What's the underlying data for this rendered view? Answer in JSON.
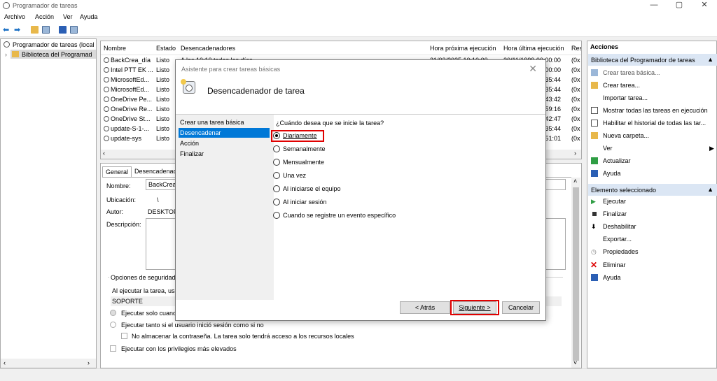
{
  "window": {
    "title": "Programador de tareas"
  },
  "menu": [
    "Archivo",
    "Acción",
    "Ver",
    "Ayuda"
  ],
  "tree": {
    "items": [
      "Programador de tareas (local",
      "Biblioteca del Programad"
    ]
  },
  "task_list": {
    "columns": [
      "Nombre",
      "Estado",
      "Desencadenadores",
      "Hora próxima ejecución",
      "Hora última ejecución",
      "Res"
    ],
    "rows": [
      {
        "name": "BackCrea_día",
        "status": "Listo",
        "trigger": "A las 10:10 todos los días",
        "next": "21/03/2025 10:10:00",
        "last": "30/11/1999 00:00:00",
        "res": "(0x"
      },
      {
        "name": "Intel PTT EK ...",
        "status": "Listo",
        "trigger": "",
        "next": "",
        "last": ":00:00",
        "res": "(0x"
      },
      {
        "name": "MicrosoftEd...",
        "status": "Listo",
        "trigger": "",
        "next": "",
        "last": ":35:44",
        "res": "(0x"
      },
      {
        "name": "MicrosoftEd...",
        "status": "Listo",
        "trigger": "",
        "next": "",
        "last": ":35:44",
        "res": "(0x"
      },
      {
        "name": "OneDrive Pe...",
        "status": "Listo",
        "trigger": "",
        "next": "",
        "last": ":43:42",
        "res": "(0x"
      },
      {
        "name": "OneDrive Re...",
        "status": "Listo",
        "trigger": "",
        "next": "",
        "last": ":59:16",
        "res": "(0x"
      },
      {
        "name": "OneDrive St...",
        "status": "Listo",
        "trigger": "",
        "next": "",
        "last": ":42:47",
        "res": "(0x"
      },
      {
        "name": "update-S-1-...",
        "status": "Listo",
        "trigger": "",
        "next": "",
        "last": ":35:44",
        "res": "(0x"
      },
      {
        "name": "update-sys",
        "status": "Listo",
        "trigger": "",
        "next": "",
        "last": ":51:01",
        "res": "(0x"
      }
    ]
  },
  "details": {
    "tabs": [
      "General",
      "Desencadenac"
    ],
    "name_label": "Nombre:",
    "name_value": "BackCrea_",
    "location_label": "Ubicación:",
    "location_value": "\\",
    "author_label": "Autor:",
    "author_value": "DESKTOP-",
    "description_label": "Descripción:",
    "security_group": "Opciones de seguridad",
    "run_as_text": "Al ejecutar la tarea, usar",
    "user": "SOPORTE",
    "opt1": "Ejecutar solo cuand",
    "opt2": "Ejecutar tanto si el usuario inició sesión como si no",
    "opt3": "No almacenar la contraseña. La tarea solo tendrá acceso a los recursos locales",
    "opt4": "Ejecutar con los privilegios más elevados"
  },
  "actions": {
    "header": "Acciones",
    "section1": "Biblioteca del Programador de tareas",
    "items1": [
      "Crear tarea básica...",
      "Crear tarea...",
      "Importar tarea...",
      "Mostrar todas las tareas en ejecución",
      "Habilitar el historial de todas las tar...",
      "Nueva carpeta...",
      "Ver",
      "Actualizar",
      "Ayuda"
    ],
    "section2": "Elemento seleccionado",
    "items2": [
      "Ejecutar",
      "Finalizar",
      "Deshabilitar",
      "Exportar...",
      "Propiedades",
      "Eliminar",
      "Ayuda"
    ]
  },
  "dialog": {
    "title": "Asistente para crear tareas básicas",
    "header": "Desencadenador de tarea",
    "steps": [
      "Crear una tarea básica",
      "Desencadenar",
      "Acción",
      "Finalizar"
    ],
    "active_step": 1,
    "question": "¿Cuándo desea que se inicie la tarea?",
    "options": [
      "Diariamente",
      "Semanalmente",
      "Mensualmente",
      "Una vez",
      "Al iniciarse el equipo",
      "Al iniciar sesión",
      "Cuando se registre un evento específico"
    ],
    "selected": 0,
    "back": "< Atrás",
    "next": "Siguiente >",
    "cancel": "Cancelar"
  },
  "colors": {
    "highlight": "#0078d7",
    "annotation": "#e00000"
  }
}
